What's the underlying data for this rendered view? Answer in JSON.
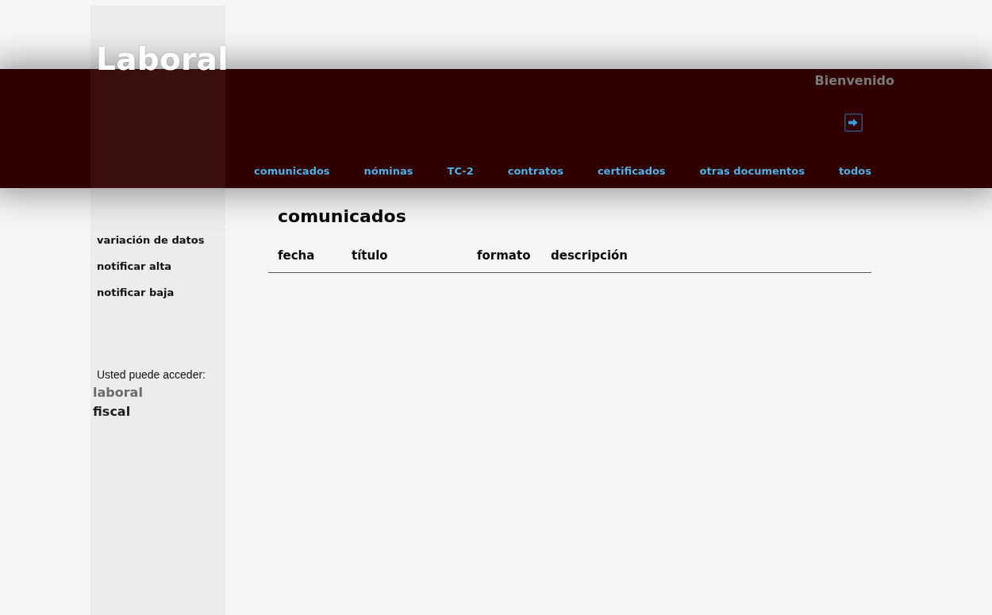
{
  "header": {
    "title": "Laboral",
    "greeting": "Bienvenido",
    "nav": [
      {
        "label": "comunicados",
        "selected": false
      },
      {
        "label": "nóminas",
        "selected": false
      },
      {
        "label": "TC-2",
        "selected": false
      },
      {
        "label": "contratos",
        "selected": false
      },
      {
        "label": "certificados",
        "selected": false
      },
      {
        "label": "otras documentos",
        "selected": false
      },
      {
        "label": "todos",
        "selected": false
      }
    ]
  },
  "sidebar": {
    "items": [
      "variación de datos",
      "notificar alta",
      "notificar baja"
    ],
    "access_label": "Usted puede acceder:",
    "access_links": [
      {
        "label": "laboral",
        "selected": true
      },
      {
        "label": "fiscal",
        "selected": false
      }
    ]
  },
  "main": {
    "title": "comunicados",
    "table": {
      "columns": [
        "fecha",
        "título",
        "formato",
        "descripción"
      ]
    }
  }
}
